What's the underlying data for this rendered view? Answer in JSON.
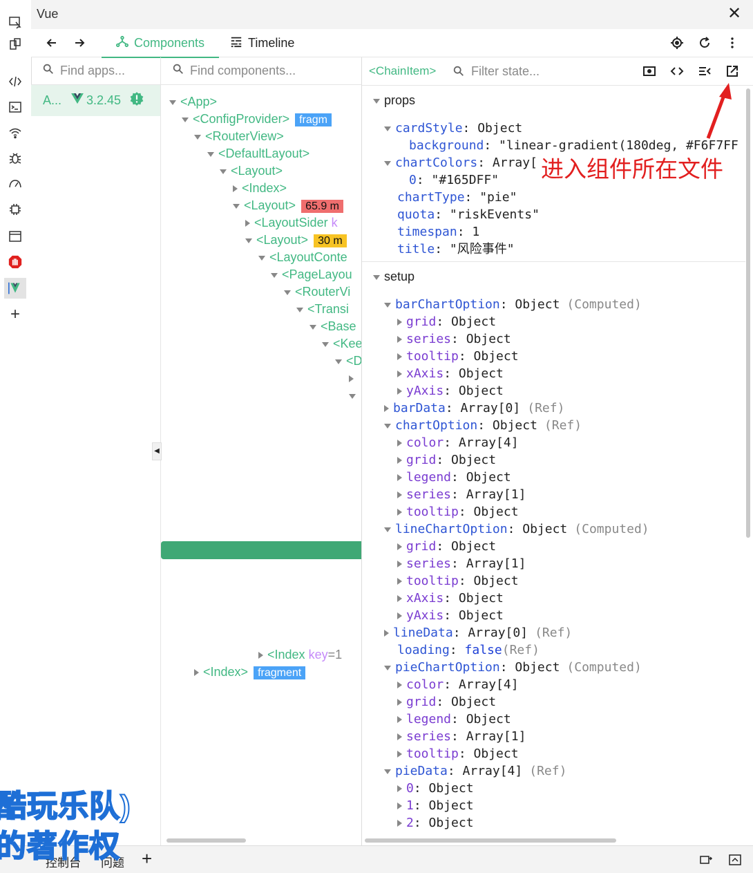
{
  "window": {
    "title": "Vue",
    "close_icon": "✕"
  },
  "nav": {
    "tab_components": "Components",
    "tab_timeline": "Timeline"
  },
  "apps": {
    "search_placeholder": "Find apps...",
    "app_name": "A...",
    "app_version": "3.2.45"
  },
  "tree": {
    "search_placeholder": "Find components...",
    "nodes": {
      "app": "<App>",
      "config_provider": "<ConfigProvider>",
      "config_provider_badge": "fragm",
      "router_view": "<RouterView>",
      "default_layout": "<DefaultLayout>",
      "layout1": "<Layout>",
      "index1": "<Index>",
      "layout2": "<Layout>",
      "layout2_badge": "65.9 m",
      "layout_sider": "<LayoutSider",
      "layout_sider_key": "k",
      "layout3": "<Layout>",
      "layout3_badge": "30 m",
      "layout_content": "<LayoutConte",
      "page_layout": "<PageLayou",
      "router_view2": "<RouterVi",
      "transition": "<Transi",
      "base": "<Base",
      "keep": "<Kee",
      "d": "<D",
      "index_key": "<Index",
      "index_key_attr": "key",
      "index_key_val": "=1",
      "index_last": "<Index>",
      "index_last_badge": "fragment"
    }
  },
  "state": {
    "component_name": "<ChainItem>",
    "filter_placeholder": "Filter state...",
    "props_title": "props",
    "setup_title": "setup",
    "annotation": "进入组件所在文件",
    "props": {
      "cardStyle_key": "cardStyle",
      "cardStyle_val": ": Object",
      "background_key": "background",
      "background_val": ": \"linear-gradient(180deg, #F6F7FF",
      "chartColors_key": "chartColors",
      "chartColors_val": ": Array[",
      "c0_key": "0",
      "c0_val": ": \"#165DFF\"",
      "chartType_key": "chartType",
      "chartType_val": ": \"pie\"",
      "quota_key": "quota",
      "quota_val": ": \"riskEvents\"",
      "timespan_key": "timespan",
      "timespan_val": ": 1",
      "title_key": "title",
      "title_val": ": \"风险事件\""
    },
    "setup": [
      {
        "indent": 0,
        "arrow": "down",
        "key": "barChartOption",
        "val": ": Object",
        "hint": "(Computed)"
      },
      {
        "indent": 1,
        "arrow": "right",
        "key": "grid",
        "val": ": Object",
        "hint": ""
      },
      {
        "indent": 1,
        "arrow": "right",
        "key": "series",
        "val": ": Object",
        "hint": ""
      },
      {
        "indent": 1,
        "arrow": "right",
        "key": "tooltip",
        "val": ": Object",
        "hint": ""
      },
      {
        "indent": 1,
        "arrow": "right",
        "key": "xAxis",
        "val": ": Object",
        "hint": ""
      },
      {
        "indent": 1,
        "arrow": "right",
        "key": "yAxis",
        "val": ": Object",
        "hint": ""
      },
      {
        "indent": 0,
        "arrow": "right",
        "key": "barData",
        "val": ": Array[0]",
        "hint": "(Ref)"
      },
      {
        "indent": 0,
        "arrow": "down",
        "key": "chartOption",
        "val": ": Object",
        "hint": "(Ref)"
      },
      {
        "indent": 1,
        "arrow": "right",
        "key": "color",
        "val": ": Array[4]",
        "hint": ""
      },
      {
        "indent": 1,
        "arrow": "right",
        "key": "grid",
        "val": ": Object",
        "hint": ""
      },
      {
        "indent": 1,
        "arrow": "right",
        "key": "legend",
        "val": ": Object",
        "hint": ""
      },
      {
        "indent": 1,
        "arrow": "right",
        "key": "series",
        "val": ": Array[1]",
        "hint": ""
      },
      {
        "indent": 1,
        "arrow": "right",
        "key": "tooltip",
        "val": ": Object",
        "hint": ""
      },
      {
        "indent": 0,
        "arrow": "down",
        "key": "lineChartOption",
        "val": ": Object",
        "hint": "(Computed)"
      },
      {
        "indent": 1,
        "arrow": "right",
        "key": "grid",
        "val": ": Object",
        "hint": ""
      },
      {
        "indent": 1,
        "arrow": "right",
        "key": "series",
        "val": ": Array[1]",
        "hint": ""
      },
      {
        "indent": 1,
        "arrow": "right",
        "key": "tooltip",
        "val": ": Object",
        "hint": ""
      },
      {
        "indent": 1,
        "arrow": "right",
        "key": "xAxis",
        "val": ": Object",
        "hint": ""
      },
      {
        "indent": 1,
        "arrow": "right",
        "key": "yAxis",
        "val": ": Object",
        "hint": ""
      },
      {
        "indent": 0,
        "arrow": "right",
        "key": "lineData",
        "val": ": Array[0]",
        "hint": "(Ref)"
      },
      {
        "indent": 0,
        "arrow": "none",
        "key": "loading",
        "val": ": ",
        "bool": "false",
        "hint": "(Ref)"
      },
      {
        "indent": 0,
        "arrow": "down",
        "key": "pieChartOption",
        "val": ": Object",
        "hint": "(Computed)"
      },
      {
        "indent": 1,
        "arrow": "right",
        "key": "color",
        "val": ": Array[4]",
        "hint": ""
      },
      {
        "indent": 1,
        "arrow": "right",
        "key": "grid",
        "val": ": Object",
        "hint": ""
      },
      {
        "indent": 1,
        "arrow": "right",
        "key": "legend",
        "val": ": Object",
        "hint": ""
      },
      {
        "indent": 1,
        "arrow": "right",
        "key": "series",
        "val": ": Array[1]",
        "hint": ""
      },
      {
        "indent": 1,
        "arrow": "right",
        "key": "tooltip",
        "val": ": Object",
        "hint": ""
      },
      {
        "indent": 0,
        "arrow": "down",
        "key": "pieData",
        "val": ": Array[4]",
        "hint": "(Ref)"
      },
      {
        "indent": 1,
        "arrow": "right",
        "key": "0",
        "val": ": Object",
        "hint": ""
      },
      {
        "indent": 1,
        "arrow": "right",
        "key": "1",
        "val": ": Object",
        "hint": ""
      },
      {
        "indent": 1,
        "arrow": "right",
        "key": "2",
        "val": ": Object",
        "hint": ""
      }
    ]
  },
  "bottom": {
    "tab_console": "控制台",
    "tab_issues": "问题"
  },
  "watermark": {
    "line1": "酷玩乐队)",
    "line2": "的著作权"
  },
  "colors": {
    "accent": "#42b883",
    "badge_red": "#ef6e6e",
    "badge_yellow": "#f7c324",
    "badge_blue": "#4ba3f7"
  }
}
